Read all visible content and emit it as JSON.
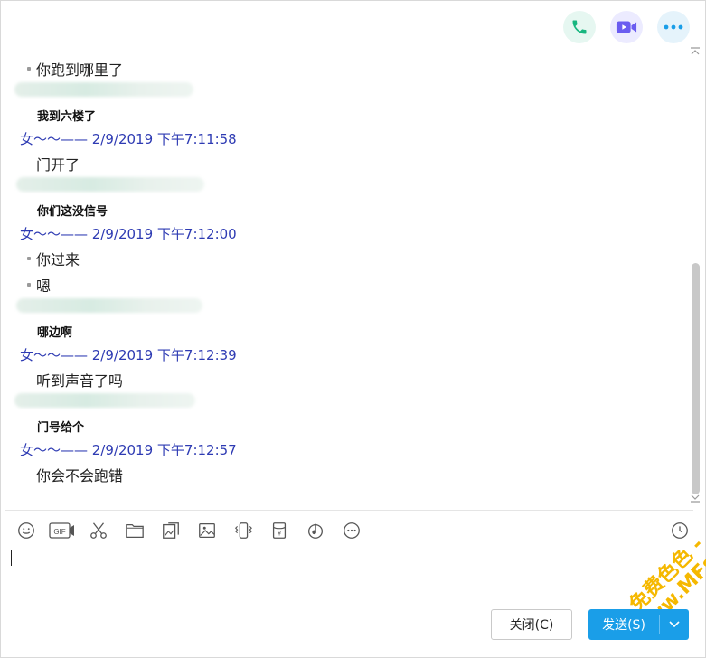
{
  "header": {
    "icons": [
      "phone-icon",
      "video-icon",
      "more-icon"
    ],
    "colors": {
      "phone": "#17b67f",
      "video": "#6a5cf0",
      "more": "#1a9ee8"
    }
  },
  "messages": [
    {
      "kind": "bullet",
      "text": "你跑到哪里了"
    },
    {
      "kind": "blurred"
    },
    {
      "kind": "bold",
      "text": "我到六楼了"
    },
    {
      "kind": "meta",
      "text": "女～～—— 2/9/2019 下午7:11:58"
    },
    {
      "kind": "plain",
      "text": "门开了"
    },
    {
      "kind": "blurred"
    },
    {
      "kind": "bold",
      "text": "你们这没信号"
    },
    {
      "kind": "meta",
      "text": "女～～—— 2/9/2019 下午7:12:00"
    },
    {
      "kind": "bullet",
      "text": "你过来"
    },
    {
      "kind": "bullet",
      "text": "嗯"
    },
    {
      "kind": "blurred"
    },
    {
      "kind": "bold",
      "text": "哪边啊"
    },
    {
      "kind": "meta",
      "text": "女～～—— 2/9/2019 下午7:12:39"
    },
    {
      "kind": "plain",
      "text": "听到声音了吗"
    },
    {
      "kind": "blurred"
    },
    {
      "kind": "bold",
      "text": "门号给个"
    },
    {
      "kind": "meta",
      "text": "女～～—— 2/9/2019 下午7:12:57"
    },
    {
      "kind": "plain",
      "text": "你会不会跑错"
    }
  ],
  "toolbar": {
    "icons": [
      "emoji-icon",
      "gif-icon",
      "scissors-icon",
      "folder-icon",
      "image-edit-icon",
      "image-icon",
      "shake-icon",
      "red-packet-icon",
      "music-icon",
      "more-options-icon"
    ],
    "gif_label": "GIF"
  },
  "watermark": {
    "line1": "- 免费色色 -",
    "line2": "www.MFsese.com"
  },
  "footer": {
    "close_label": "关闭(C)",
    "send_label": "发送(S)",
    "send_color": "#1a9ee8"
  }
}
